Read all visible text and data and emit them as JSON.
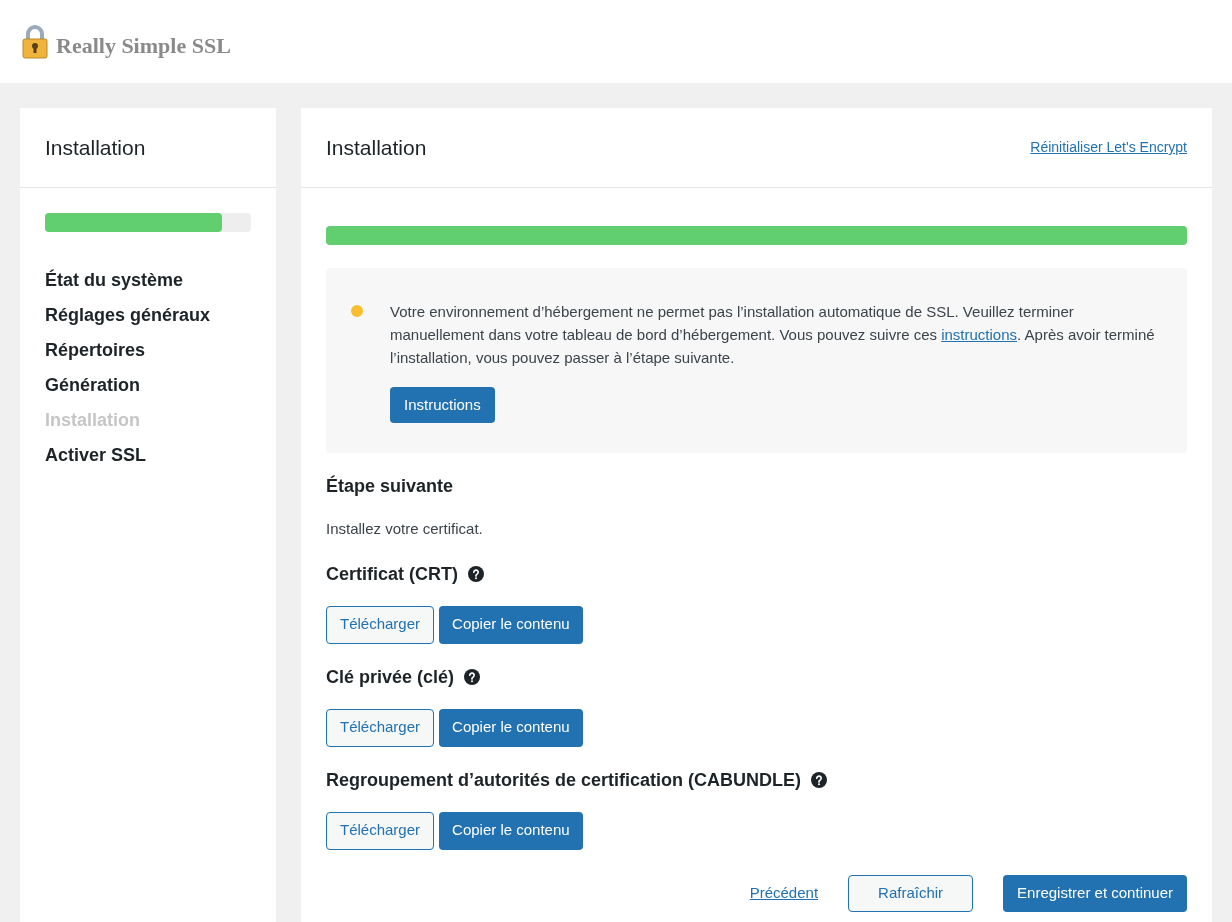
{
  "header": {
    "logo_text": "Really Simple SSL"
  },
  "sidebar": {
    "title": "Installation",
    "progress": {
      "level": 0.86
    },
    "items": [
      {
        "label": "État du système",
        "selected": false
      },
      {
        "label": "Réglages généraux",
        "selected": false
      },
      {
        "label": "Répertoires",
        "selected": false
      },
      {
        "label": "Génération",
        "selected": false
      },
      {
        "label": "Installation",
        "selected": true
      },
      {
        "label": "Activer SSL",
        "selected": false
      }
    ]
  },
  "main": {
    "title": "Installation",
    "reset_link": "Réinitialiser Let's Encrypt",
    "progress": {
      "level": 1
    },
    "notice": {
      "kind": "warning",
      "text_before": "Votre environnement d’hébergement ne permet pas l’installation automatique de SSL. Veuillez terminer manuellement dans votre tableau de bord d’hébergement. Vous pouvez suivre ces",
      "link": "instructions",
      "text_after": ". Après avoir terminé l’installation, vous pouvez passer à l’étape suivante.",
      "button": "Instructions"
    },
    "next_step": {
      "title": "Étape suivante",
      "description": "Installez votre certificat."
    },
    "files": [
      {
        "label": "Certificat (CRT)",
        "download": "Télécharger",
        "copy": "Copier le contenu"
      },
      {
        "label": "Clé privée (clé)",
        "download": "Télécharger",
        "copy": "Copier le contenu"
      },
      {
        "label": "Regroupement d’autorités de certification (CABUNDLE)",
        "download": "Télécharger",
        "copy": "Copier le contenu"
      }
    ],
    "footer": {
      "previous": "Précédent",
      "refresh": "Rafraîchir",
      "save": "Enregistrer et continuer"
    }
  }
}
